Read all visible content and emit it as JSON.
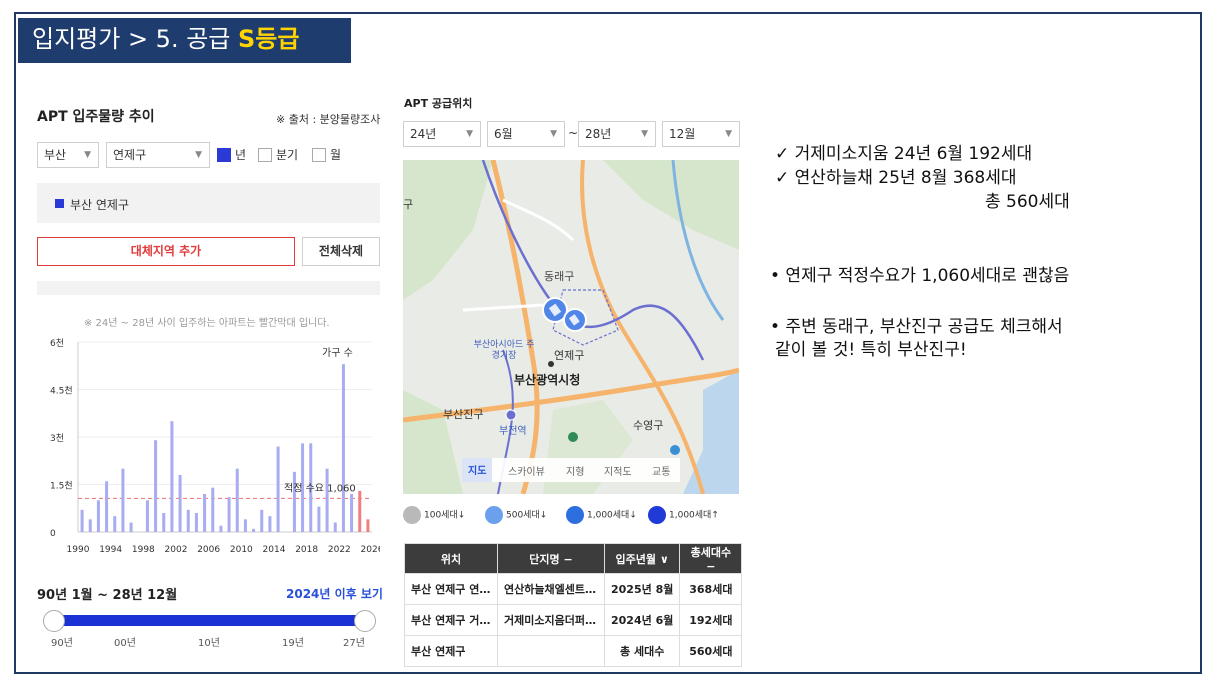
{
  "title": {
    "prefix": "입지평가 > 5. 공급 ",
    "grade": "S등급"
  },
  "left_panel": {
    "title": "APT 입주물량 추이",
    "source": "※ 출처 : 분양물량조사",
    "region_select": "부산",
    "district_select": "연제구",
    "period_options": [
      {
        "label": "년",
        "checked": true
      },
      {
        "label": "분기",
        "checked": false
      },
      {
        "label": "월",
        "checked": false
      }
    ],
    "selected_region": "부산 연제구",
    "add_button": "대체지역 추가",
    "delete_button": "전체삭제",
    "chart_note": "※ 24년 ~ 28년 사이 입주하는 아파트는 빨간막대 입니다.",
    "range_label": "90년 1월 ~ 28년 12월",
    "range_link": "2024년 이후 보기",
    "slider_ticks": [
      "90년",
      "00년",
      "10년",
      "19년",
      "27년"
    ]
  },
  "chart_data": {
    "type": "bar",
    "x": [
      1990,
      1991,
      1992,
      1993,
      1994,
      1995,
      1996,
      1997,
      1998,
      1999,
      2000,
      2001,
      2002,
      2003,
      2004,
      2005,
      2006,
      2007,
      2008,
      2009,
      2010,
      2011,
      2012,
      2013,
      2014,
      2015,
      2016,
      2017,
      2018,
      2019,
      2020,
      2021,
      2022,
      2023,
      2024,
      2025
    ],
    "values": [
      700,
      400,
      1000,
      1600,
      500,
      2000,
      300,
      0,
      1000,
      2900,
      600,
      3500,
      1800,
      700,
      600,
      1200,
      1400,
      200,
      1100,
      2000,
      400,
      100,
      700,
      500,
      2700,
      0,
      1900,
      2800,
      2800,
      800,
      2000,
      300,
      5300,
      1200,
      1300,
      400
    ],
    "highlight_from": 2024,
    "bar_color": "#a8acf0",
    "highlight_color": "#f08080",
    "yticks": [
      "6천",
      "4.5천",
      "3천",
      "1.5천",
      "0"
    ],
    "ylim": [
      0,
      6000
    ],
    "xticks": [
      "1990",
      "1994",
      "1998",
      "2002",
      "2006",
      "2010",
      "2014",
      "2018",
      "2022",
      "2026"
    ],
    "series_label": "가구 수",
    "reference_line": {
      "value": 1060,
      "label": "적정 수요 1,060"
    }
  },
  "middle_panel": {
    "title": "APT 공급위치",
    "from_year": "24년",
    "from_month": "6월",
    "tilde": "~",
    "to_year": "28년",
    "to_month": "12월",
    "map_labels": {
      "dongnae": "동래구",
      "asiad": "부산아시아드 주경기장",
      "yeonje": "연제구",
      "cityhall": "부산광역시청",
      "busanjin": "부산진구",
      "bujeon": "부전역",
      "suyeong": "수영구",
      "gu_left": "구"
    },
    "map_tabs": [
      "지도",
      "스카이뷰",
      "지형",
      "지적도",
      "교통"
    ],
    "legend": [
      "100세대↓",
      "500세대↓",
      "1,000세대↓",
      "1,000세대↑"
    ],
    "table": {
      "headers": [
        "위치",
        "단지명 −",
        "입주년월 ∨",
        "총세대수 −"
      ],
      "rows": [
        [
          "부산 연제구 연…",
          "연산하늘채엘센트…",
          "2025년 8월",
          "368세대"
        ],
        [
          "부산 연제구 거…",
          "거제미소지음더퍼…",
          "2024년 6월",
          "192세대"
        ]
      ],
      "total": {
        "location": "부산 연제구",
        "label": "총 세대수",
        "value": "560세대"
      }
    }
  },
  "notes": {
    "line1": "✓ 거제미소지움  24년 6월 192세대",
    "line2": "✓ 연산하늘채     25년 8월 368세대",
    "line3": "총 560세대",
    "bullet1": "• 연제구 적정수요가 1,060세대로 괜찮음",
    "bullet2a": "• 주변 동래구, 부산진구 공급도 체크해서",
    "bullet2b": "같이 볼 것! 특히 부산진구!"
  }
}
